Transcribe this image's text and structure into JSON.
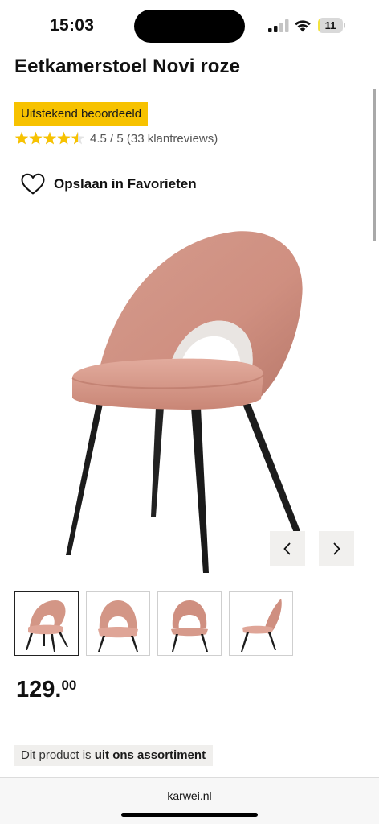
{
  "status_bar": {
    "time": "15:03",
    "battery_level": "11",
    "battery_fraction": 0.11,
    "signal_icon": "cellular-signal-icon",
    "wifi_icon": "wifi-icon",
    "battery_icon": "battery-icon",
    "battery_color": "#f3e33d"
  },
  "product": {
    "title": "Eetkamerstoel Novi roze",
    "badge": "Uitstekend beoordeeld",
    "rating_value": 4.5,
    "rating_max": 5,
    "rating_text": "4.5 / 5 (33 klantreviews)",
    "star_color": "#f7c200",
    "badge_color": "#f7c200",
    "favorite_icon": "heart-outline-icon",
    "favorite_label": "Opslaan in Favorieten",
    "image_description_icon": "product-chair-image",
    "prev_icon": "chevron-left-icon",
    "next_icon": "chevron-right-icon",
    "thumbnails": [
      {
        "view": "front-angle",
        "selected": true
      },
      {
        "view": "front",
        "selected": false
      },
      {
        "view": "back",
        "selected": false
      },
      {
        "view": "side",
        "selected": false
      }
    ],
    "price_whole": "129.",
    "price_cents": "00",
    "availability_prefix": "Dit product is ",
    "availability_bold": "uit ons assortiment"
  },
  "browser": {
    "url": "karwei.nl"
  },
  "colors": {
    "chair_pink": "#d99a8a",
    "chair_legs": "#1c1c1c"
  }
}
